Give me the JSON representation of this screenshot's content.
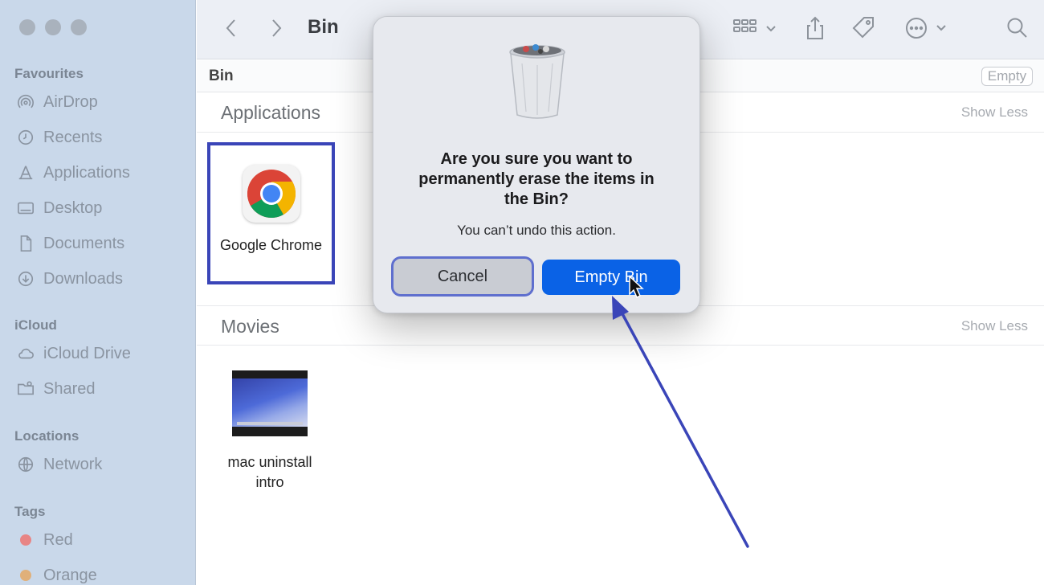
{
  "sidebar": {
    "favourites_heading": "Favourites",
    "favourites": [
      {
        "label": "AirDrop",
        "icon": "airdrop-icon"
      },
      {
        "label": "Recents",
        "icon": "clock-icon"
      },
      {
        "label": "Applications",
        "icon": "applications-icon"
      },
      {
        "label": "Desktop",
        "icon": "desktop-icon"
      },
      {
        "label": "Documents",
        "icon": "document-icon"
      },
      {
        "label": "Downloads",
        "icon": "download-icon"
      }
    ],
    "icloud_heading": "iCloud",
    "icloud": [
      {
        "label": "iCloud Drive",
        "icon": "cloud-icon"
      },
      {
        "label": "Shared",
        "icon": "shared-folder-icon"
      }
    ],
    "locations_heading": "Locations",
    "locations": [
      {
        "label": "Network",
        "icon": "globe-icon"
      }
    ],
    "tags_heading": "Tags",
    "tags": [
      {
        "label": "Red",
        "color": "#e86a6a"
      },
      {
        "label": "Orange",
        "color": "#e8a55a"
      }
    ]
  },
  "toolbar": {
    "title": "Bin",
    "icons": [
      "back-icon",
      "forward-icon",
      "view-grid-icon",
      "share-icon",
      "tag-icon",
      "more-icon",
      "search-icon"
    ]
  },
  "pathbar": {
    "crumb": "Bin",
    "empty_label": "Empty"
  },
  "groups": {
    "applications": {
      "title": "Applications",
      "toggle": "Show Less"
    },
    "movies": {
      "title": "Movies",
      "toggle": "Show Less"
    }
  },
  "files": {
    "chrome": {
      "label": "Google Chrome",
      "icon": "chrome-icon"
    },
    "movie": {
      "label_line1": "mac uninstall",
      "label_line2": "intro"
    }
  },
  "dialog": {
    "icon": "trash-bin-icon",
    "title_line1": "Are you sure you want to",
    "title_line2": "permanently erase the items in",
    "title_line3": "the Bin?",
    "message": "You can’t undo this action.",
    "cancel_label": "Cancel",
    "confirm_label": "Empty Bin"
  },
  "annotation": {
    "arrow_color": "#3a45b8",
    "highlight_color": "#3a45b8"
  }
}
